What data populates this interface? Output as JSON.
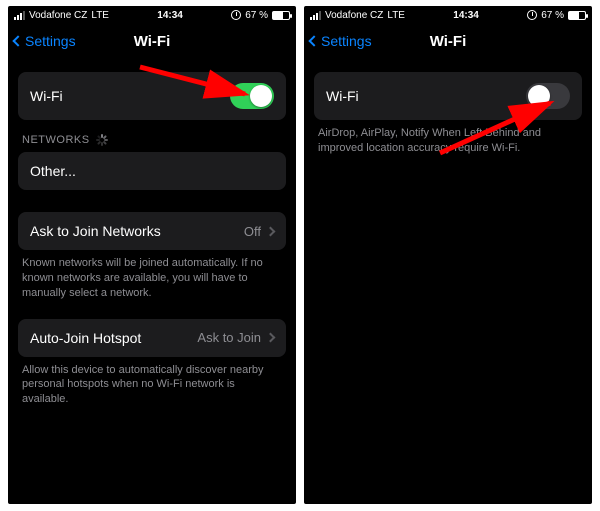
{
  "status": {
    "carrier": "Vodafone CZ",
    "network": "LTE",
    "time": "14:34",
    "battery_pct": "67 %"
  },
  "nav": {
    "back_label": "Settings",
    "title": "Wi-Fi"
  },
  "left": {
    "wifi_row_label": "Wi-Fi",
    "networks_header": "NETWORKS",
    "other_label": "Other...",
    "ask_join_label": "Ask to Join Networks",
    "ask_join_value": "Off",
    "ask_join_desc": "Known networks will be joined automatically. If no known networks are available, you will have to manually select a network.",
    "auto_hotspot_label": "Auto-Join Hotspot",
    "auto_hotspot_value": "Ask to Join",
    "auto_hotspot_desc": "Allow this device to automatically discover nearby personal hotspots when no Wi-Fi network is available."
  },
  "right": {
    "wifi_row_label": "Wi-Fi",
    "wifi_off_desc": "AirDrop, AirPlay, Notify When Left Behind and improved location accuracy require Wi-Fi."
  }
}
